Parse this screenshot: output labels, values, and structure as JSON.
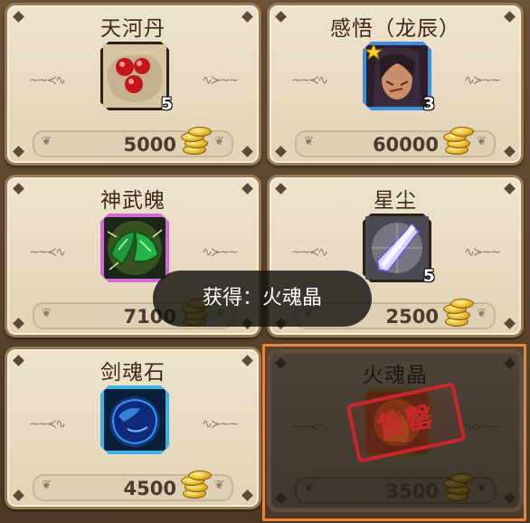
{
  "items": [
    {
      "name": "天河丹",
      "quantity": "5",
      "price": "5000",
      "icon": "red-pills-icon",
      "sold": false
    },
    {
      "name": "感悟（龙辰）",
      "quantity": "3",
      "price": "60000",
      "icon": "hero-portrait-icon",
      "sold": false
    },
    {
      "name": "神武魄",
      "quantity": "",
      "price": "7100",
      "icon": "green-soul-stone-icon",
      "sold": false
    },
    {
      "name": "星尘",
      "quantity": "5",
      "price": "2500",
      "icon": "crystal-shard-icon",
      "sold": false
    },
    {
      "name": "剑魂石",
      "quantity": "",
      "price": "4500",
      "icon": "blue-gem-icon",
      "sold": false
    },
    {
      "name": "火魂晶",
      "quantity": "",
      "price": "3500",
      "icon": "fire-crystal-icon",
      "sold": true
    }
  ],
  "toast": {
    "text": "获得：火魂晶"
  },
  "stamp": {
    "text": "售罄"
  },
  "colors": {
    "accent": "#e8843c",
    "stamp": "#c9282a",
    "card_bg": "#efe3cd"
  }
}
